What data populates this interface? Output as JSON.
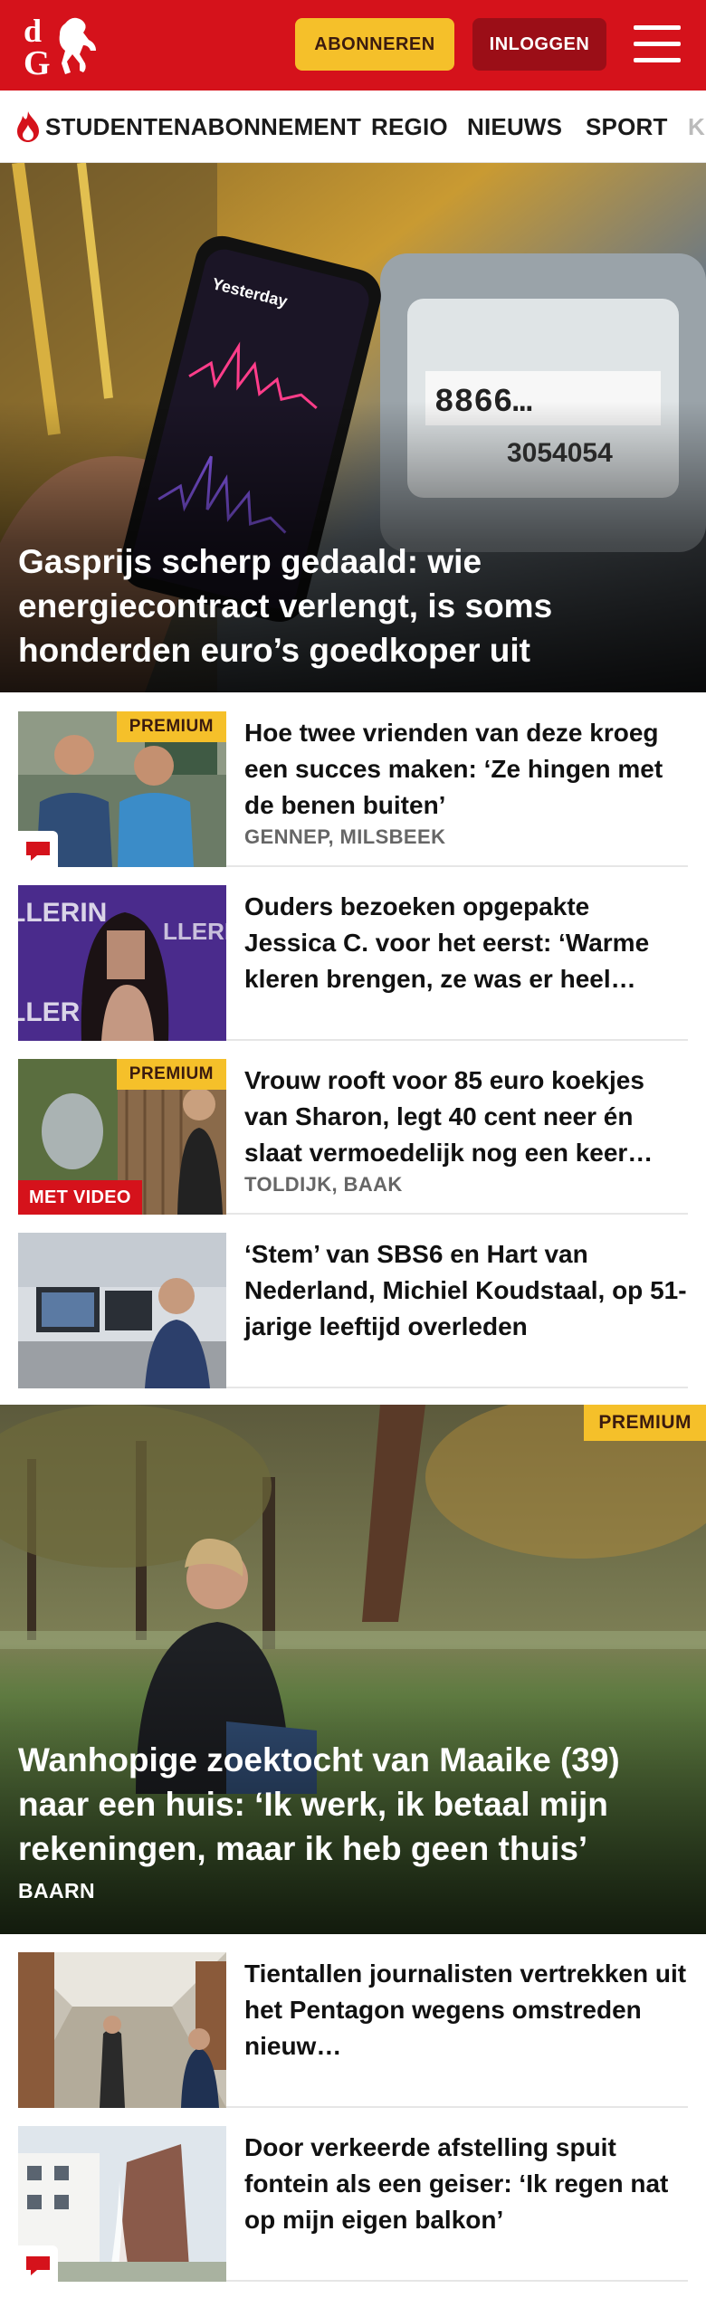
{
  "header": {
    "subscribe_label": "ABONNEREN",
    "login_label": "INLOGGEN",
    "brand_color": "#d5121b",
    "subscribe_color": "#f5c02a"
  },
  "nav": {
    "items": [
      "STUDENTENABONNEMENT",
      "REGIO",
      "NIEUWS",
      "SPORT",
      "K"
    ]
  },
  "hero": {
    "title": "Gasprijs scherp gedaald: wie energiecontract verlengt, is soms honderden euro’s goedkoper uit"
  },
  "articles": [
    {
      "title": "Hoe twee vrienden van deze kroeg een succes maken: ‘Ze hingen met de benen buiten’",
      "place": "GENNEP, MILSBEEK",
      "badge": "PREMIUM",
      "icon": "comment-icon"
    },
    {
      "title": "Ouders bezoeken opgepakte Jessica C. voor het eerst: ‘Warme kleren brengen, ze was er heel…"
    },
    {
      "title": "Vrouw rooft voor 85 euro koekjes van Sharon, legt 40 cent neer én slaat vermoedelijk nog een keer…",
      "place": "TOLDIJK, BAAK",
      "badge": "PREMIUM",
      "video_label": "MET VIDEO"
    },
    {
      "title": "‘Stem’ van SBS6 en Hart van Nederland, Michiel Koudstaal, op 51-jarige leeftijd overleden"
    }
  ],
  "feature": {
    "badge": "PREMIUM",
    "title": "Wanhopige zoektocht van Maaike (39) naar een huis: ‘Ik werk, ik betaal mijn rekeningen, maar ik heb geen thuis’",
    "place": "BAARN"
  },
  "articles2": [
    {
      "title": "Tientallen journalisten vertrekken uit het Pentagon wegens omstreden nieuw…"
    },
    {
      "title": "Door verkeerde afstelling spuit fontein als een geiser: ‘Ik regen nat op mijn eigen balkon’",
      "icon": "comment-icon"
    }
  ]
}
